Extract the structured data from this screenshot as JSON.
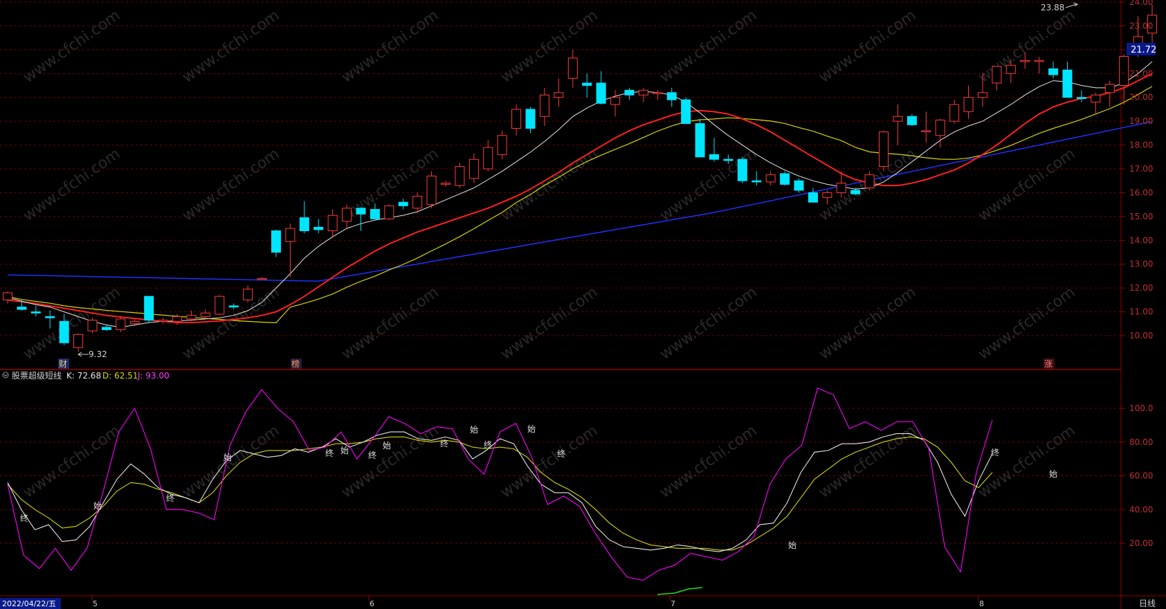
{
  "price_panel": {
    "ticks": [
      "24.00",
      "23.00",
      "22.00",
      "21.00",
      "20.00",
      "19.00",
      "18.00",
      "17.00",
      "16.00",
      "15.00",
      "14.00",
      "13.00",
      "12.00",
      "11.00",
      "10.00"
    ],
    "current_price": "21.72",
    "high_label": "23.88",
    "low_label": "9.32",
    "markers": [
      "财",
      "榜",
      "涨"
    ],
    "watermark": "www.cfchi.com"
  },
  "indicator": {
    "name": "股票超级短线",
    "k_label": "K: 72.68",
    "d_label": "D: 62.51",
    "j_label": "J: 93.00",
    "ticks": [
      "100.0",
      "80.00",
      "60.00",
      "40.00",
      "20.00"
    ],
    "start_label": "始",
    "end_label": "终"
  },
  "time_axis": {
    "first_date": "2022/04/22/五",
    "months": [
      "5",
      "6",
      "7",
      "8"
    ],
    "period": "日线"
  },
  "colors": {
    "up": "#ff3b3b",
    "down": "#00e5ff",
    "ma5": "#e8e8e8",
    "ma10": "#ff2020",
    "ma20": "#d8d800",
    "ma60": "#2030ff",
    "k": "#e8e8e8",
    "d": "#d8d800",
    "j": "#ff00ff",
    "grid": "#7a0000"
  },
  "chart_data": {
    "type": "candlestick",
    "candles": [
      {
        "o": 11.5,
        "h": 11.85,
        "l": 11.35,
        "c": 11.8
      },
      {
        "o": 11.2,
        "h": 11.5,
        "l": 11.05,
        "c": 11.1
      },
      {
        "o": 11.0,
        "h": 11.25,
        "l": 10.8,
        "c": 10.95
      },
      {
        "o": 10.8,
        "h": 11.05,
        "l": 10.3,
        "c": 10.75
      },
      {
        "o": 10.6,
        "h": 10.9,
        "l": 9.6,
        "c": 9.7
      },
      {
        "o": 9.5,
        "h": 10.1,
        "l": 9.32,
        "c": 10.05
      },
      {
        "o": 10.2,
        "h": 10.75,
        "l": 10.1,
        "c": 10.65
      },
      {
        "o": 10.35,
        "h": 10.45,
        "l": 10.2,
        "c": 10.25
      },
      {
        "o": 10.25,
        "h": 10.8,
        "l": 10.15,
        "c": 10.7
      },
      {
        "o": 10.5,
        "h": 10.7,
        "l": 10.4,
        "c": 10.6
      },
      {
        "o": 11.65,
        "h": 11.65,
        "l": 10.55,
        "c": 10.65
      },
      {
        "o": 10.6,
        "h": 10.75,
        "l": 10.5,
        "c": 10.65
      },
      {
        "o": 10.6,
        "h": 10.9,
        "l": 10.45,
        "c": 10.8
      },
      {
        "o": 10.7,
        "h": 11.05,
        "l": 10.6,
        "c": 10.85
      },
      {
        "o": 10.8,
        "h": 11.1,
        "l": 10.7,
        "c": 10.95
      },
      {
        "o": 10.9,
        "h": 11.7,
        "l": 10.85,
        "c": 11.65
      },
      {
        "o": 11.25,
        "h": 11.35,
        "l": 11.1,
        "c": 11.2
      },
      {
        "o": 11.5,
        "h": 12.1,
        "l": 11.4,
        "c": 11.95
      },
      {
        "o": 12.4,
        "h": 12.45,
        "l": 12.35,
        "c": 12.4
      },
      {
        "o": 14.4,
        "h": 14.45,
        "l": 13.3,
        "c": 13.5
      },
      {
        "o": 13.95,
        "h": 14.7,
        "l": 12.45,
        "c": 14.5
      },
      {
        "o": 14.95,
        "h": 15.65,
        "l": 14.3,
        "c": 14.4
      },
      {
        "o": 14.55,
        "h": 14.9,
        "l": 14.3,
        "c": 14.45
      },
      {
        "o": 14.4,
        "h": 15.3,
        "l": 14.1,
        "c": 15.05
      },
      {
        "o": 14.8,
        "h": 15.5,
        "l": 14.5,
        "c": 15.35
      },
      {
        "o": 15.35,
        "h": 15.35,
        "l": 14.4,
        "c": 15.1
      },
      {
        "o": 15.3,
        "h": 15.55,
        "l": 14.9,
        "c": 14.9
      },
      {
        "o": 14.9,
        "h": 15.5,
        "l": 14.85,
        "c": 15.45
      },
      {
        "o": 15.6,
        "h": 15.75,
        "l": 15.3,
        "c": 15.45
      },
      {
        "o": 15.35,
        "h": 16.0,
        "l": 15.15,
        "c": 15.85
      },
      {
        "o": 15.5,
        "h": 16.9,
        "l": 15.35,
        "c": 16.7
      },
      {
        "o": 16.35,
        "h": 16.5,
        "l": 16.25,
        "c": 16.4
      },
      {
        "o": 16.3,
        "h": 17.25,
        "l": 16.2,
        "c": 17.1
      },
      {
        "o": 16.6,
        "h": 17.65,
        "l": 16.4,
        "c": 17.4
      },
      {
        "o": 17.0,
        "h": 18.2,
        "l": 16.9,
        "c": 17.9
      },
      {
        "o": 17.6,
        "h": 18.6,
        "l": 17.4,
        "c": 18.4
      },
      {
        "o": 18.7,
        "h": 19.7,
        "l": 18.4,
        "c": 19.5
      },
      {
        "o": 19.5,
        "h": 19.6,
        "l": 18.5,
        "c": 18.7
      },
      {
        "o": 19.2,
        "h": 20.4,
        "l": 18.8,
        "c": 20.1
      },
      {
        "o": 20.0,
        "h": 20.8,
        "l": 19.6,
        "c": 20.2
      },
      {
        "o": 20.8,
        "h": 22.0,
        "l": 20.4,
        "c": 21.65
      },
      {
        "o": 20.6,
        "h": 21.0,
        "l": 20.0,
        "c": 20.5
      },
      {
        "o": 20.6,
        "h": 21.1,
        "l": 19.7,
        "c": 19.75
      },
      {
        "o": 19.7,
        "h": 20.3,
        "l": 19.2,
        "c": 20.0
      },
      {
        "o": 20.3,
        "h": 20.4,
        "l": 19.9,
        "c": 20.1
      },
      {
        "o": 20.1,
        "h": 20.4,
        "l": 19.8,
        "c": 20.3
      },
      {
        "o": 20.2,
        "h": 20.3,
        "l": 19.9,
        "c": 20.2
      },
      {
        "o": 20.2,
        "h": 20.4,
        "l": 19.6,
        "c": 19.9
      },
      {
        "o": 19.9,
        "h": 20.0,
        "l": 18.9,
        "c": 18.9
      },
      {
        "o": 18.9,
        "h": 19.1,
        "l": 17.5,
        "c": 17.5
      },
      {
        "o": 17.6,
        "h": 18.3,
        "l": 17.3,
        "c": 17.4
      },
      {
        "o": 17.4,
        "h": 17.6,
        "l": 17.2,
        "c": 17.35
      },
      {
        "o": 17.4,
        "h": 17.5,
        "l": 16.4,
        "c": 16.5
      },
      {
        "o": 16.5,
        "h": 16.9,
        "l": 16.3,
        "c": 16.45
      },
      {
        "o": 16.45,
        "h": 16.9,
        "l": 16.3,
        "c": 16.75
      },
      {
        "o": 16.8,
        "h": 16.9,
        "l": 16.3,
        "c": 16.35
      },
      {
        "o": 16.5,
        "h": 16.6,
        "l": 16.0,
        "c": 16.1
      },
      {
        "o": 16.0,
        "h": 16.2,
        "l": 15.6,
        "c": 15.6
      },
      {
        "o": 15.8,
        "h": 16.1,
        "l": 15.5,
        "c": 16.0
      },
      {
        "o": 16.0,
        "h": 16.9,
        "l": 15.8,
        "c": 16.4
      },
      {
        "o": 16.1,
        "h": 16.2,
        "l": 15.9,
        "c": 15.95
      },
      {
        "o": 16.2,
        "h": 16.9,
        "l": 16.1,
        "c": 16.75
      },
      {
        "o": 17.1,
        "h": 18.6,
        "l": 16.9,
        "c": 18.55
      },
      {
        "o": 19.0,
        "h": 19.7,
        "l": 18.0,
        "c": 19.2
      },
      {
        "o": 19.2,
        "h": 19.3,
        "l": 18.8,
        "c": 18.85
      },
      {
        "o": 18.6,
        "h": 19.4,
        "l": 18.1,
        "c": 18.6
      },
      {
        "o": 18.4,
        "h": 19.1,
        "l": 17.9,
        "c": 19.05
      },
      {
        "o": 19.0,
        "h": 19.9,
        "l": 18.9,
        "c": 19.7
      },
      {
        "o": 19.4,
        "h": 20.5,
        "l": 19.1,
        "c": 20.0
      },
      {
        "o": 20.0,
        "h": 21.0,
        "l": 19.6,
        "c": 20.2
      },
      {
        "o": 20.6,
        "h": 21.2,
        "l": 20.3,
        "c": 21.3
      },
      {
        "o": 21.0,
        "h": 21.6,
        "l": 20.6,
        "c": 21.35
      },
      {
        "o": 21.5,
        "h": 21.9,
        "l": 21.2,
        "c": 21.55
      },
      {
        "o": 21.5,
        "h": 21.7,
        "l": 21.0,
        "c": 21.55
      },
      {
        "o": 21.2,
        "h": 21.5,
        "l": 20.8,
        "c": 20.95
      },
      {
        "o": 21.15,
        "h": 21.5,
        "l": 20.0,
        "c": 20.0
      },
      {
        "o": 20.0,
        "h": 20.3,
        "l": 19.8,
        "c": 19.95
      },
      {
        "o": 19.8,
        "h": 20.2,
        "l": 19.3,
        "c": 20.1
      },
      {
        "o": 20.2,
        "h": 20.7,
        "l": 19.6,
        "c": 20.55
      },
      {
        "o": 20.5,
        "h": 21.8,
        "l": 19.7,
        "c": 21.72
      },
      {
        "o": 21.8,
        "h": 23.4,
        "l": 21.7,
        "c": 22.55
      },
      {
        "o": 22.7,
        "h": 23.88,
        "l": 22.3,
        "c": 23.45
      }
    ],
    "ma5": [
      11.6,
      11.45,
      11.3,
      11.2,
      11.0,
      10.8,
      10.6,
      10.45,
      10.35,
      10.45,
      10.55,
      10.6,
      10.62,
      10.65,
      10.7,
      10.75,
      10.85,
      11.05,
      11.4,
      12.0,
      12.6,
      13.25,
      13.75,
      14.15,
      14.5,
      14.7,
      14.85,
      14.95,
      15.05,
      15.2,
      15.45,
      15.7,
      15.95,
      16.2,
      16.55,
      16.9,
      17.3,
      17.7,
      18.15,
      18.65,
      19.2,
      19.55,
      19.85,
      20.05,
      20.2,
      20.25,
      20.2,
      20.1,
      19.8,
      19.35,
      18.85,
      18.4,
      18.0,
      17.6,
      17.25,
      16.95,
      16.7,
      16.5,
      16.35,
      16.25,
      16.15,
      16.2,
      16.45,
      16.85,
      17.3,
      17.75,
      18.2,
      18.55,
      18.8,
      19.0,
      19.35,
      19.7,
      20.1,
      20.45,
      20.7,
      20.65,
      20.5,
      20.4,
      20.4,
      20.6,
      21.0,
      21.5
    ],
    "ma10": [
      11.5,
      11.42,
      11.35,
      11.25,
      11.15,
      11.05,
      10.95,
      10.85,
      10.78,
      10.72,
      10.66,
      10.6,
      10.55,
      10.55,
      10.58,
      10.62,
      10.68,
      10.75,
      10.85,
      11.0,
      11.3,
      11.65,
      12.05,
      12.45,
      12.85,
      13.2,
      13.55,
      13.85,
      14.1,
      14.35,
      14.55,
      14.75,
      14.95,
      15.15,
      15.35,
      15.6,
      15.85,
      16.15,
      16.5,
      16.85,
      17.25,
      17.6,
      17.95,
      18.3,
      18.6,
      18.85,
      19.05,
      19.25,
      19.4,
      19.45,
      19.4,
      19.3,
      19.1,
      18.85,
      18.55,
      18.2,
      17.85,
      17.5,
      17.15,
      16.8,
      16.55,
      16.4,
      16.3,
      16.3,
      16.4,
      16.55,
      16.75,
      16.95,
      17.25,
      17.6,
      18.0,
      18.45,
      18.9,
      19.3,
      19.6,
      19.8,
      19.95,
      20.05,
      20.2,
      20.4,
      20.7,
      21.0
    ]
  }
}
